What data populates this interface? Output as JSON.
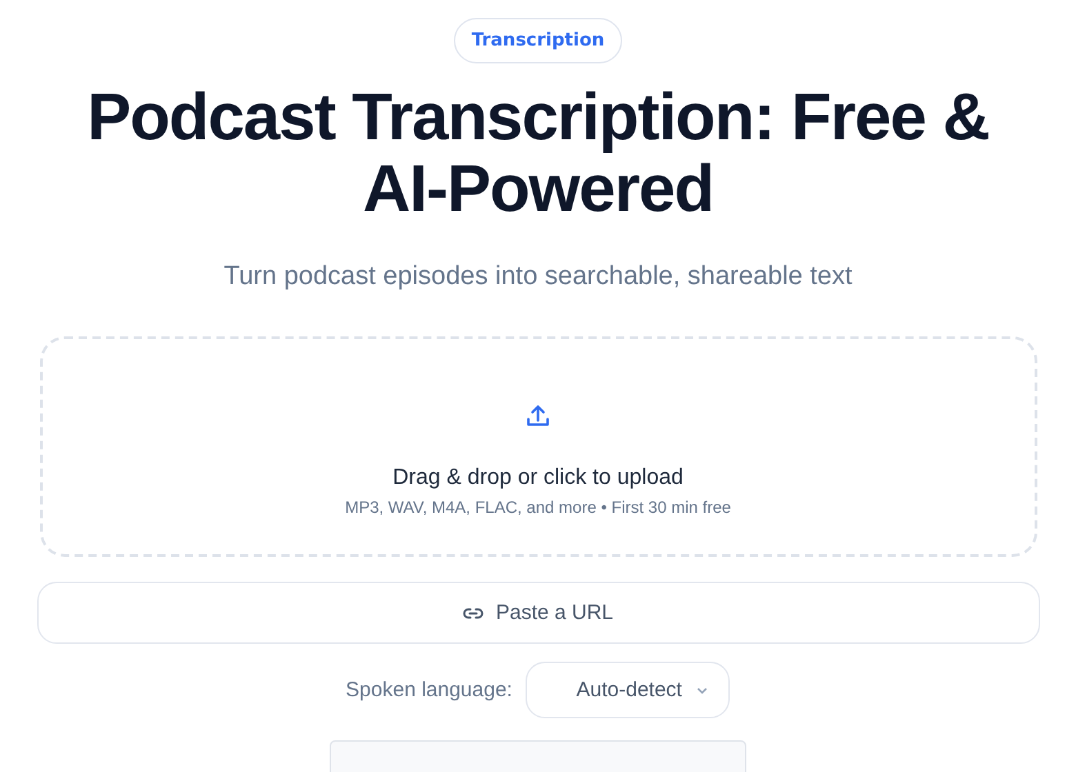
{
  "badge": "Transcription",
  "title": "Podcast Transcription: Free & AI-Powered",
  "subtitle": "Turn podcast episodes into searchable, shareable text",
  "upload": {
    "title": "Drag & drop or click to upload",
    "hint": "MP3, WAV, M4A, FLAC, and more • First 30 min free"
  },
  "url_button": "Paste a URL",
  "language": {
    "label": "Spoken language:",
    "value": "Auto-detect"
  }
}
